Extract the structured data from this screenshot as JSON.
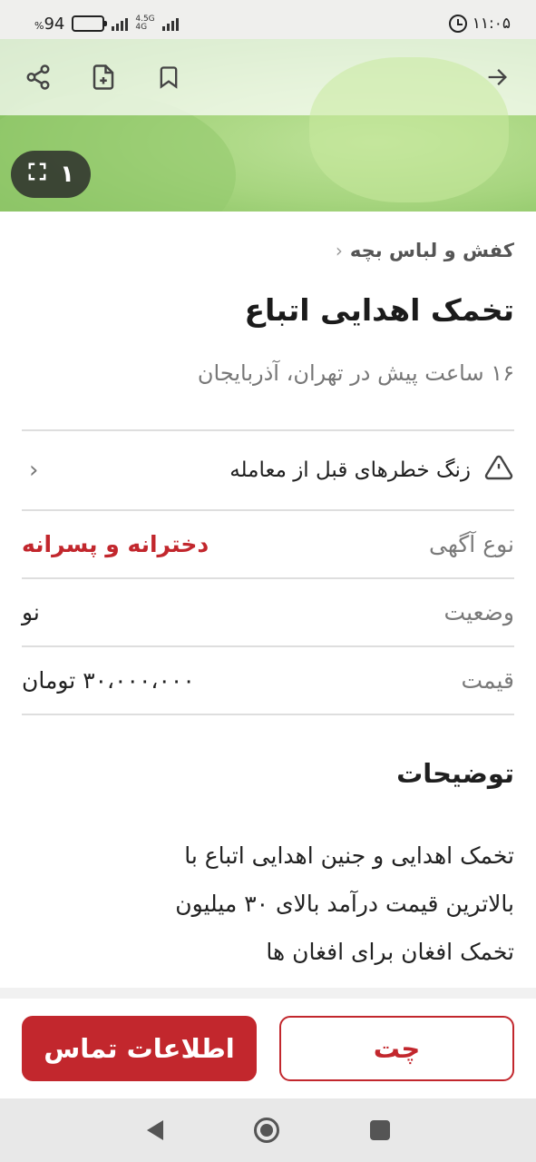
{
  "status_bar": {
    "battery": "94",
    "battery_percent_sign": "%",
    "network_top": "4.5G",
    "network_bottom": "4G",
    "time": "۱۱:۰۵"
  },
  "hero": {
    "image_counter": "۱",
    "icons": [
      "share-icon",
      "add-note-icon",
      "bookmark-icon",
      "arrow-right-icon",
      "fullscreen-icon"
    ]
  },
  "breadcrumb": {
    "label": "کفش و لباس بچه"
  },
  "post": {
    "title": "تخمک اهدایی اتباع",
    "subtitle": "۱۶ ساعت پیش در تهران، آذربایجان"
  },
  "warning": {
    "label": "زنگ خطرهای قبل از معامله"
  },
  "details": [
    {
      "label": "نوع آگهی",
      "value": "دخترانه و پسرانه"
    },
    {
      "label": "وضعیت",
      "value": "نو"
    },
    {
      "label": "قیمت",
      "value": "۳۰،۰۰۰،۰۰۰ تومان"
    }
  ],
  "description": {
    "title": "توضیحات",
    "lines": [
      "تخمک اهدایی و جنین اهدایی اتباع با",
      "بالاترین قیمت درآمد بالای ۳۰ میلیون",
      "تخمک افغان برای افغان ها"
    ]
  },
  "actions": {
    "contact_label": "اطلاعات تماس",
    "chat_label": "چت"
  },
  "colors": {
    "accent": "#c2272d"
  }
}
